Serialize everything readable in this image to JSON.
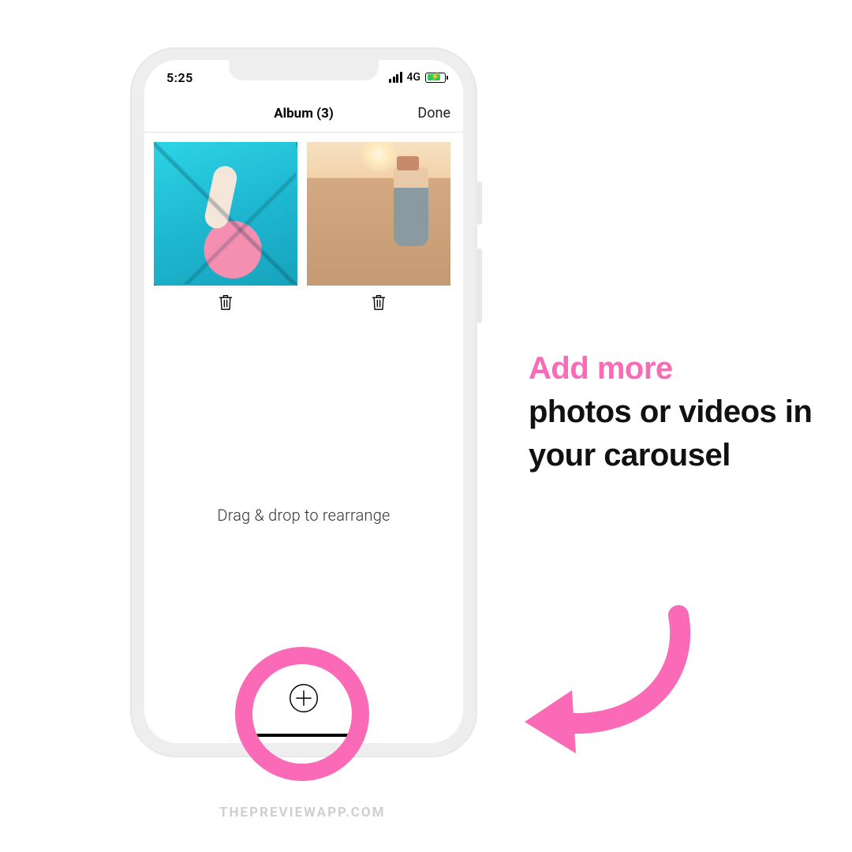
{
  "statusbar": {
    "time": "5:25",
    "network": "4G"
  },
  "navbar": {
    "title": "Album (3)",
    "done": "Done"
  },
  "hint": "Drag & drop to rearrange",
  "callout": {
    "line1": "Add more",
    "rest": "photos or videos in your carousel"
  },
  "watermark": "THEPREVIEWAPP.COM",
  "colors": {
    "pink": "#fa6ab6"
  }
}
